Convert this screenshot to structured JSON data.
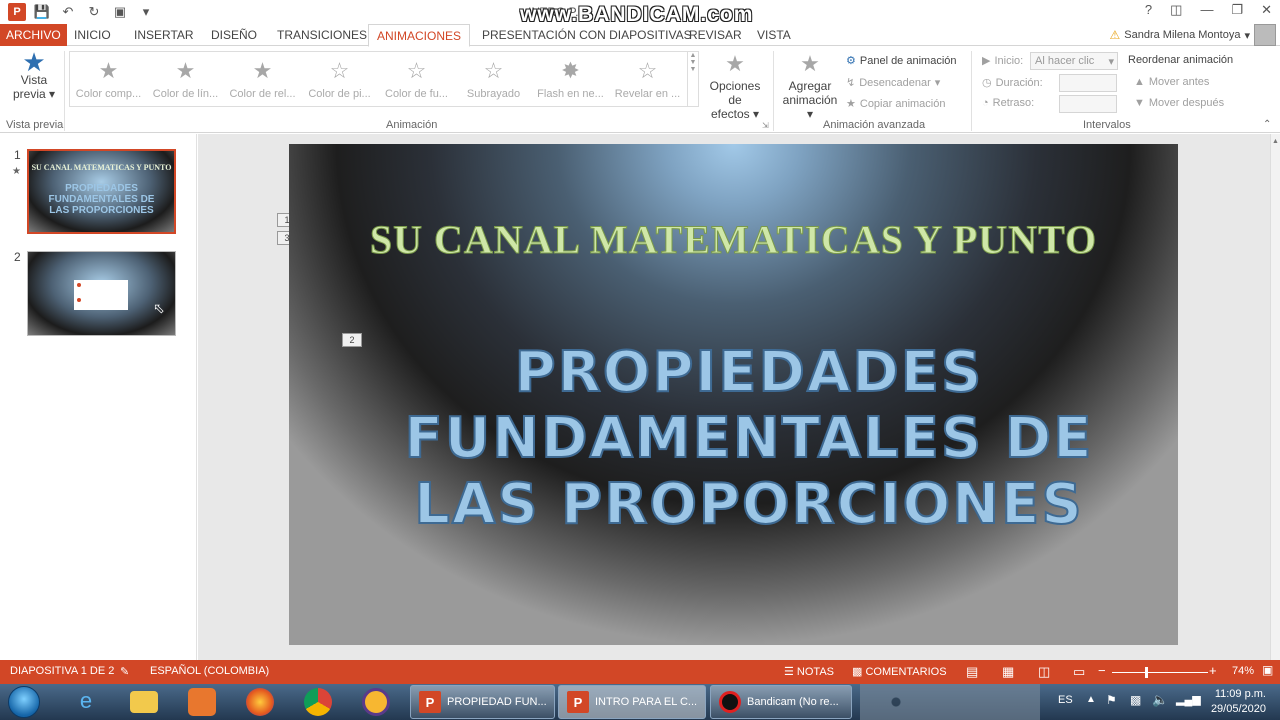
{
  "app": {
    "doc_title": "INTRO P...",
    "watermark": "www.BANDICAM.com",
    "user": "Sandra Milena Montoya",
    "help": "?",
    "colors": {
      "accent": "#d24726",
      "slide_title": "#9cc6e6",
      "slide_subtitle": "#cfe7a8"
    }
  },
  "tabs": [
    "ARCHIVO",
    "INICIO",
    "INSERTAR",
    "DISEÑO",
    "TRANSICIONES",
    "ANIMACIONES",
    "PRESENTACIÓN CON DIAPOSITIVAS",
    "REVISAR",
    "VISTA"
  ],
  "ribbon": {
    "preview": {
      "label1": "Vista",
      "label2": "previa",
      "group": "Vista previa"
    },
    "gallery": [
      "Color comp...",
      "Color de lín...",
      "Color de rel...",
      "Color de pi...",
      "Color de fu...",
      "Subrayado",
      "Flash en ne...",
      "Revelar en ..."
    ],
    "gallery_glyphs": [
      "",
      "",
      "",
      "A",
      "A",
      "S",
      "N",
      "N"
    ],
    "effect_options": {
      "label1": "Opciones de",
      "label2": "efectos"
    },
    "group_animation": "Animación",
    "add_animation": {
      "label1": "Agregar",
      "label2": "animación"
    },
    "animation_pane": "Panel de animación",
    "trigger": "Desencadenar",
    "copy_animation": "Copiar animación",
    "group_advanced": "Animación avanzada",
    "start_label": "Inicio:",
    "start_value": "Al hacer clic",
    "duration_label": "Duración:",
    "delay_label": "Retraso:",
    "group_timing": "Intervalos",
    "reorder": "Reordenar animación",
    "move_earlier": "Mover antes",
    "move_later": "Mover después"
  },
  "thumbnails": [
    {
      "num": "1",
      "line1": "SU CANAL MATEMATICAS Y PUNTO",
      "line2": "PROPIEDADES",
      "line3": "FUNDAMENTALES DE",
      "line4": "LAS PROPORCIONES"
    },
    {
      "num": "2"
    }
  ],
  "slide": {
    "subtitle": "SU CANAL MATEMATICAS Y PUNTO",
    "title_line1": "PROPIEDADES",
    "title_line2": "FUNDAMENTALES DE",
    "title_line3": "LAS PROPORCIONES",
    "anim_tags": [
      "1",
      "3",
      "2"
    ]
  },
  "status": {
    "slide_count": "DIAPOSITIVA 1 DE 2",
    "language": "ESPAÑOL (COLOMBIA)",
    "notes": "NOTAS",
    "comments": "COMENTARIOS",
    "zoom": "74%",
    "zoom_level": 0.74
  },
  "taskbar": {
    "buttons": [
      "PROPIEDAD FUN...",
      "INTRO PARA EL C...",
      "Bandicam (No re..."
    ],
    "lang": "ES",
    "time": "11:09 p.m.",
    "date": "29/05/2020"
  }
}
